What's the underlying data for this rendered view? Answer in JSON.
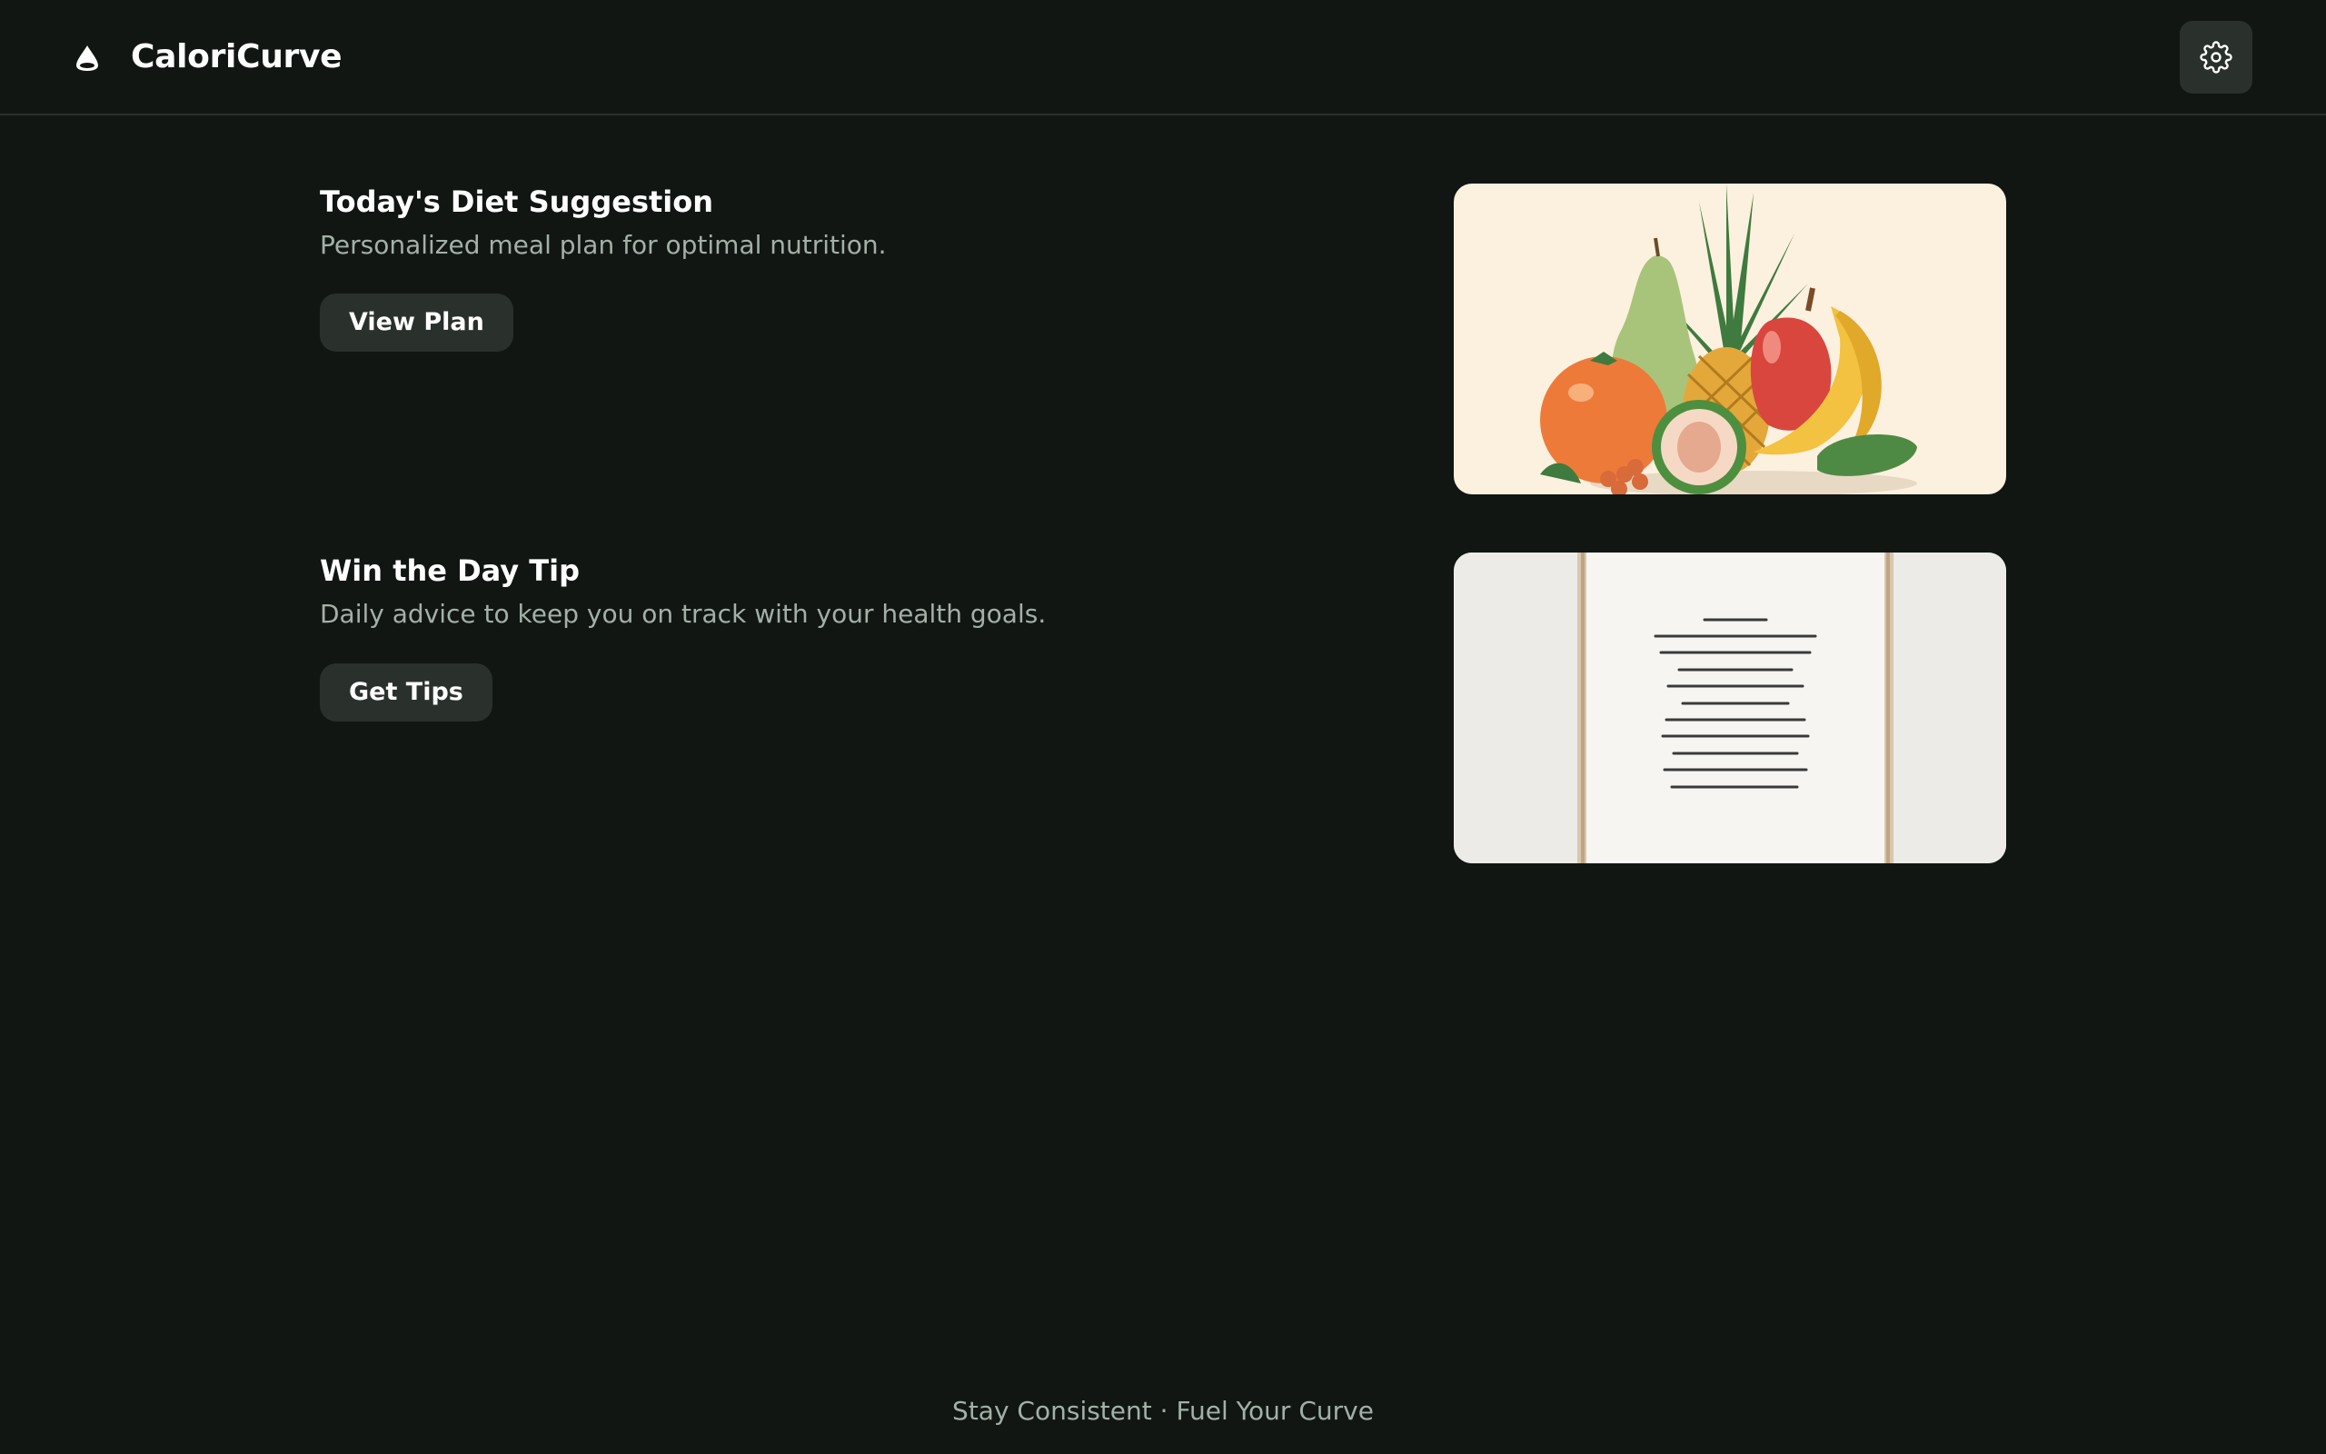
{
  "app": {
    "name": "CaloriCurve",
    "logo_icon": "water-drop-icon",
    "settings_icon": "gear-icon"
  },
  "cards": [
    {
      "title": "Today's Diet Suggestion",
      "description": "Personalized meal plan for optimal nutrition.",
      "button_label": "View Plan",
      "image": "fruit-still-life-illustration"
    },
    {
      "title": "Win the Day Tip",
      "description": "Daily advice to keep you on track with your health goals.",
      "button_label": "Get Tips",
      "image": "framed-quote-poster"
    }
  ],
  "footer": {
    "text": "Stay Consistent · Fuel Your Curve"
  },
  "colors": {
    "background": "#111613",
    "surface": "#2a302c",
    "text_primary": "#ffffff",
    "text_secondary": "#a3b0a6"
  }
}
